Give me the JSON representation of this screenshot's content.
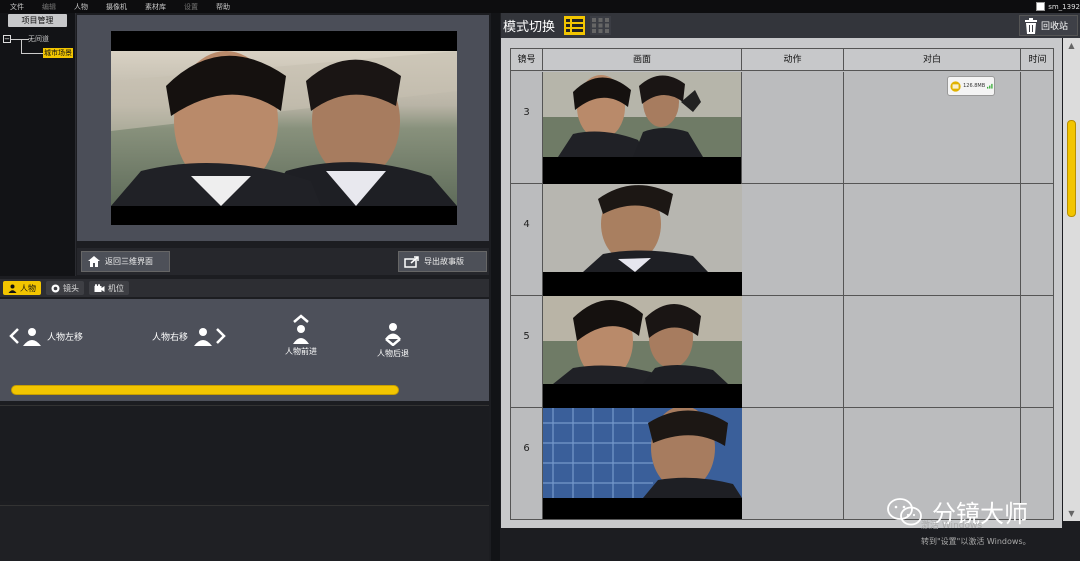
{
  "menu": {
    "items": [
      {
        "label": "文件",
        "dim": false
      },
      {
        "label": "编辑",
        "dim": true
      },
      {
        "label": "人物",
        "dim": false
      },
      {
        "label": "摄像机",
        "dim": false
      },
      {
        "label": "素材库",
        "dim": false
      },
      {
        "label": "设置",
        "dim": true
      },
      {
        "label": "帮助",
        "dim": false
      }
    ],
    "user": "sm_1392"
  },
  "tree": {
    "button": "项目管理",
    "root": "无间道",
    "child": "城市场景"
  },
  "preview": {
    "back_button": "返回三维界面",
    "export_button": "导出故事版"
  },
  "tabs": [
    {
      "label": "人物",
      "icon": "person-icon",
      "active": true
    },
    {
      "label": "镜头",
      "icon": "lens-icon",
      "active": false
    },
    {
      "label": "机位",
      "icon": "camera-icon",
      "active": false
    }
  ],
  "controls": {
    "left": "人物左移",
    "right": "人物右移",
    "forward": "人物前进",
    "backward": "人物后退",
    "slider_level": 1.0
  },
  "storyboard": {
    "title": "模式切换",
    "recycle": "回收站",
    "columns": {
      "shot": "镜号",
      "frame": "画面",
      "action": "动作",
      "dialogue": "对白",
      "time": "时间"
    },
    "rows": [
      {
        "shot": "3"
      },
      {
        "shot": "4"
      },
      {
        "shot": "5"
      },
      {
        "shot": "6"
      }
    ],
    "audio_badge": "126.8MB"
  },
  "watermark": {
    "name": "分镜大师",
    "activate_line1": "激活 Windows",
    "activate_line2": "转到\"设置\"以激活 Windows。"
  },
  "colors": {
    "accent": "#f2c500",
    "panel": "#4d505a",
    "background": "#1c1d21"
  }
}
